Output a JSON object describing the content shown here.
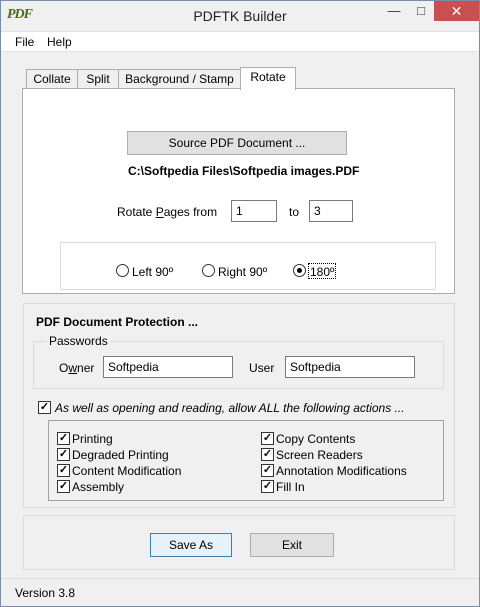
{
  "window": {
    "title": "PDFTK Builder",
    "icon_text": "PDF"
  },
  "window_controls": {
    "minimize": "—",
    "maximize": "□",
    "close": "✕"
  },
  "menu": {
    "items": [
      "File",
      "Help"
    ]
  },
  "tabs": [
    {
      "label": "Collate"
    },
    {
      "label": "Split"
    },
    {
      "label": "Background / Stamp"
    },
    {
      "label": "Rotate",
      "active": true
    }
  ],
  "rotate": {
    "source_button": "Source PDF Document ...",
    "source_path": "C:\\Softpedia Files\\Softpedia images.PDF",
    "pages_label_prefix": "Rotate ",
    "pages_label_accel": "P",
    "pages_label_suffix": "ages from",
    "from_value": "1",
    "to_label": "to",
    "to_value": "3",
    "options": [
      {
        "label": "Left 90º",
        "selected": false
      },
      {
        "label": "Right 90º",
        "selected": false
      },
      {
        "label": "180º",
        "selected": true
      }
    ]
  },
  "protection": {
    "title": "PDF Document Protection ...",
    "passwords_label": "Passwords",
    "owner_label_pre": "O",
    "owner_label_accel": "w",
    "owner_label_post": "ner",
    "owner_value": "Softpedia",
    "user_label": "User",
    "user_value": "Softpedia",
    "allow_all_label": "As well as opening and reading, allow ALL the following actions ...",
    "allow_all_checked": true,
    "permissions_left": [
      {
        "label": "Printing",
        "checked": true
      },
      {
        "label": "Degraded Printing",
        "checked": true
      },
      {
        "label": "Content Modification",
        "checked": true
      },
      {
        "label": "Assembly",
        "checked": true
      }
    ],
    "permissions_right": [
      {
        "label": "Copy Contents",
        "checked": true
      },
      {
        "label": "Screen Readers",
        "checked": true
      },
      {
        "label": "Annotation Modifications",
        "checked": true
      },
      {
        "label": "Fill In",
        "checked": true
      }
    ]
  },
  "actions": {
    "save_as": "Save As",
    "exit": "Exit"
  },
  "status": {
    "version": "Version 3.8"
  },
  "colors": {
    "accent_border": "#3c7fb1",
    "close_button": "#c75050",
    "window_bg": "#f0f0f0"
  }
}
